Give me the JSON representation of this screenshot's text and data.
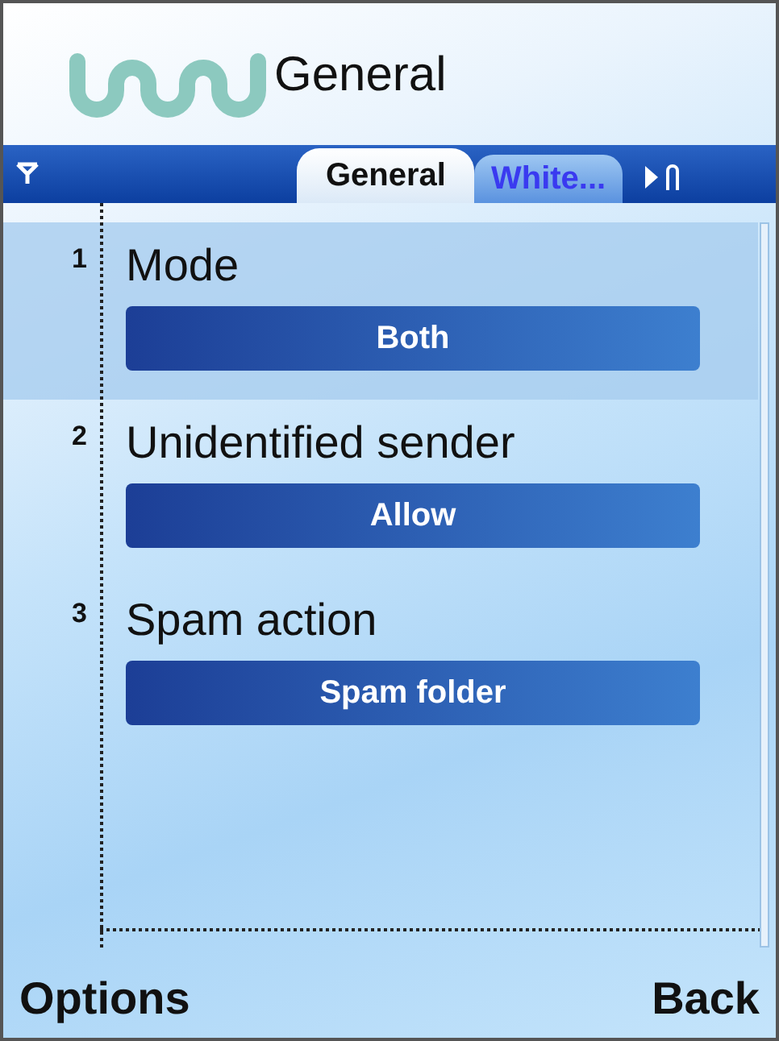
{
  "title": "General",
  "tabs": [
    {
      "label": "General",
      "selected": true
    },
    {
      "label": "White...",
      "selected": false
    }
  ],
  "settings": [
    {
      "number": "1",
      "label": "Mode",
      "value": "Both",
      "selected": true
    },
    {
      "number": "2",
      "label": "Unidentified sender",
      "value": "Allow",
      "selected": false
    },
    {
      "number": "3",
      "label": "Spam action",
      "value": "Spam folder",
      "selected": false
    }
  ],
  "softkeys": {
    "left": "Options",
    "right": "Back"
  }
}
